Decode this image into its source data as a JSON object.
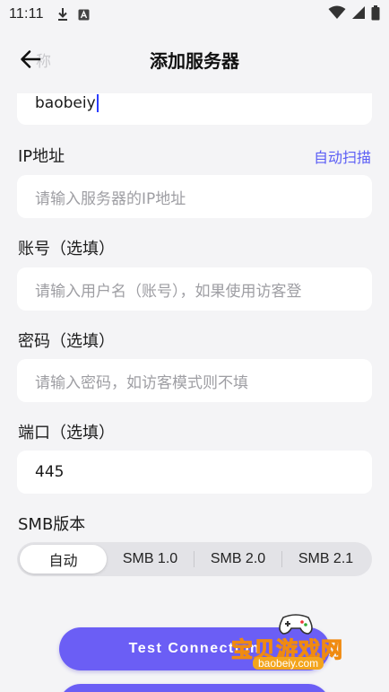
{
  "status_bar": {
    "time": "11:11",
    "icons": [
      "download-icon",
      "a-box-icon",
      "wifi-icon",
      "signal-icon",
      "battery-icon"
    ]
  },
  "header": {
    "title": "添加服务器",
    "ghost_label": "称"
  },
  "form": {
    "name_value": "baobeiy",
    "ip_label": "IP地址",
    "ip_scan_link": "自动扫描",
    "ip_placeholder": "请输入服务器的IP地址",
    "account_label": "账号（选填）",
    "account_placeholder": "请输入用户名（账号），如果使用访客登",
    "password_label": "密码（选填）",
    "password_placeholder": "请输入密码，如访客模式则不填",
    "port_label": "端口（选填）",
    "port_value": "445",
    "smb_label": "SMB版本",
    "smb_options": [
      "自动",
      "SMB 1.0",
      "SMB 2.0",
      "SMB 2.1"
    ],
    "smb_selected": "自动"
  },
  "actions": {
    "test_connection": "Test Connection"
  },
  "watermark": {
    "text": "宝贝游戏网",
    "url": "baobeiy.com"
  },
  "colors": {
    "accent": "#6b5ef5",
    "link": "#5b5ef5",
    "background": "#f4f4f6",
    "field": "#ffffff"
  }
}
